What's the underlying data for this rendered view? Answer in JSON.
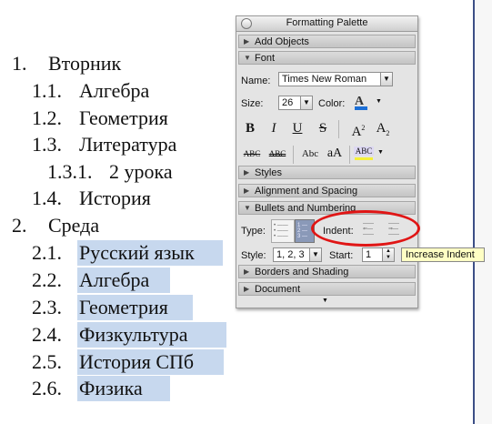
{
  "document": {
    "items": [
      {
        "num": "1.",
        "text": "Вторник",
        "selected": false
      },
      {
        "num": "1.1.",
        "text": "Алгебра",
        "selected": false
      },
      {
        "num": "1.2.",
        "text": "Геометрия",
        "selected": false
      },
      {
        "num": "1.3.",
        "text": "Литература",
        "selected": false
      },
      {
        "num": "1.3.1.",
        "text": "2 урока",
        "selected": false
      },
      {
        "num": "1.4.",
        "text": "История",
        "selected": false
      },
      {
        "num": "2.",
        "text": "Среда",
        "selected": false
      },
      {
        "num": "2.1.",
        "text": "Русский язык",
        "selected": true
      },
      {
        "num": "2.2.",
        "text": "Алгебра",
        "selected": true
      },
      {
        "num": "2.3.",
        "text": "Геометрия",
        "selected": true
      },
      {
        "num": "2.4.",
        "text": "Физкультура",
        "selected": true
      },
      {
        "num": "2.5.",
        "text": "История СПб",
        "selected": true
      },
      {
        "num": "2.6.",
        "text": "Физика",
        "selected": true
      }
    ]
  },
  "palette": {
    "title": "Formatting Palette",
    "sections": {
      "add_objects": "Add Objects",
      "font": "Font",
      "styles": "Styles",
      "alignment": "Alignment and Spacing",
      "bullets": "Bullets and Numbering",
      "borders": "Borders and Shading",
      "document": "Document"
    },
    "font": {
      "name_label": "Name:",
      "name_value": "Times New Roman",
      "size_label": "Size:",
      "size_value": "26",
      "color_label": "Color:",
      "bold": "B",
      "italic": "I",
      "underline": "U",
      "strike_s": "S",
      "superscript": "A",
      "superscript_mark": "2",
      "subscript": "A",
      "subscript_mark": "2",
      "strike_abc": "ABC",
      "dstrike_abc": "ABC",
      "smallcaps_abc": "Abc",
      "caps_aa": "aA",
      "highlight_abc": "ABC",
      "highlight_color": "#f5f03a",
      "font_color": "#1c6fd6"
    },
    "bullets": {
      "type_label": "Type:",
      "indent_label": "Indent:",
      "style_label": "Style:",
      "style_value": "1, 2, 3",
      "start_label": "Start:",
      "start_value": "1"
    }
  },
  "tooltip": "Increase Indent",
  "colors": {
    "selection": "#c7d8ee",
    "annotation_red": "#e01515",
    "tooltip_bg": "#ffffc4"
  }
}
